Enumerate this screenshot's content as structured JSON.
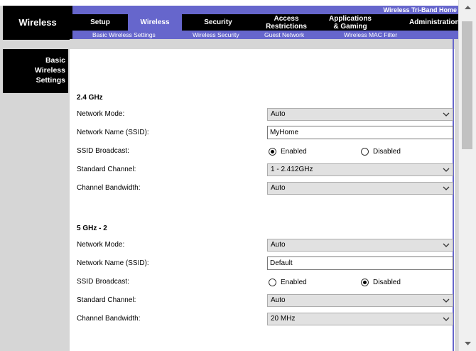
{
  "brand": {
    "title": "Wireless"
  },
  "header": {
    "product_name": "Wireless Tri-Band Home"
  },
  "tabs": [
    {
      "label": "Setup"
    },
    {
      "label": "Wireless"
    },
    {
      "label": "Security"
    },
    {
      "label_line1": "Access",
      "label_line2": "Restrictions"
    },
    {
      "label_line1": "Applications",
      "label_line2": "& Gaming"
    },
    {
      "label": "Administration"
    }
  ],
  "subtabs": [
    {
      "label": "Basic Wireless Settings"
    },
    {
      "label": "Wireless Security"
    },
    {
      "label": "Guest Network"
    },
    {
      "label": "Wireless MAC Filter"
    }
  ],
  "section": {
    "title_line1": "Basic",
    "title_line2": "Wireless",
    "title_line3": "Settings"
  },
  "band24": {
    "title": "2.4 GHz",
    "network_mode_label": "Network Mode:",
    "network_mode_value": "Auto",
    "ssid_label": "Network Name (SSID):",
    "ssid_value": "MyHome",
    "broadcast_label": "SSID Broadcast:",
    "broadcast_enabled_label": "Enabled",
    "broadcast_disabled_label": "Disabled",
    "broadcast_selected": "enabled",
    "channel_label": "Standard Channel:",
    "channel_value": "1 - 2.412GHz",
    "bandwidth_label": "Channel Bandwidth:",
    "bandwidth_value": "Auto"
  },
  "band5": {
    "title": "5 GHz - 2",
    "network_mode_label": "Network Mode:",
    "network_mode_value": "Auto",
    "ssid_label": "Network Name (SSID):",
    "ssid_value": "Default",
    "broadcast_label": "SSID Broadcast:",
    "broadcast_enabled_label": "Enabled",
    "broadcast_disabled_label": "Disabled",
    "broadcast_selected": "disabled",
    "channel_label": "Standard Channel:",
    "channel_value": "Auto",
    "bandwidth_label": "Channel Bandwidth:",
    "bandwidth_value": "20 MHz"
  },
  "colors": {
    "accent": "#6666cc",
    "header_black": "#000000",
    "page_grey": "#d6d6d6"
  },
  "icons": {
    "select_arrow": "chevron-down-icon",
    "scroll_up": "scroll-up-arrow-icon",
    "scroll_down": "scroll-down-arrow-icon"
  }
}
